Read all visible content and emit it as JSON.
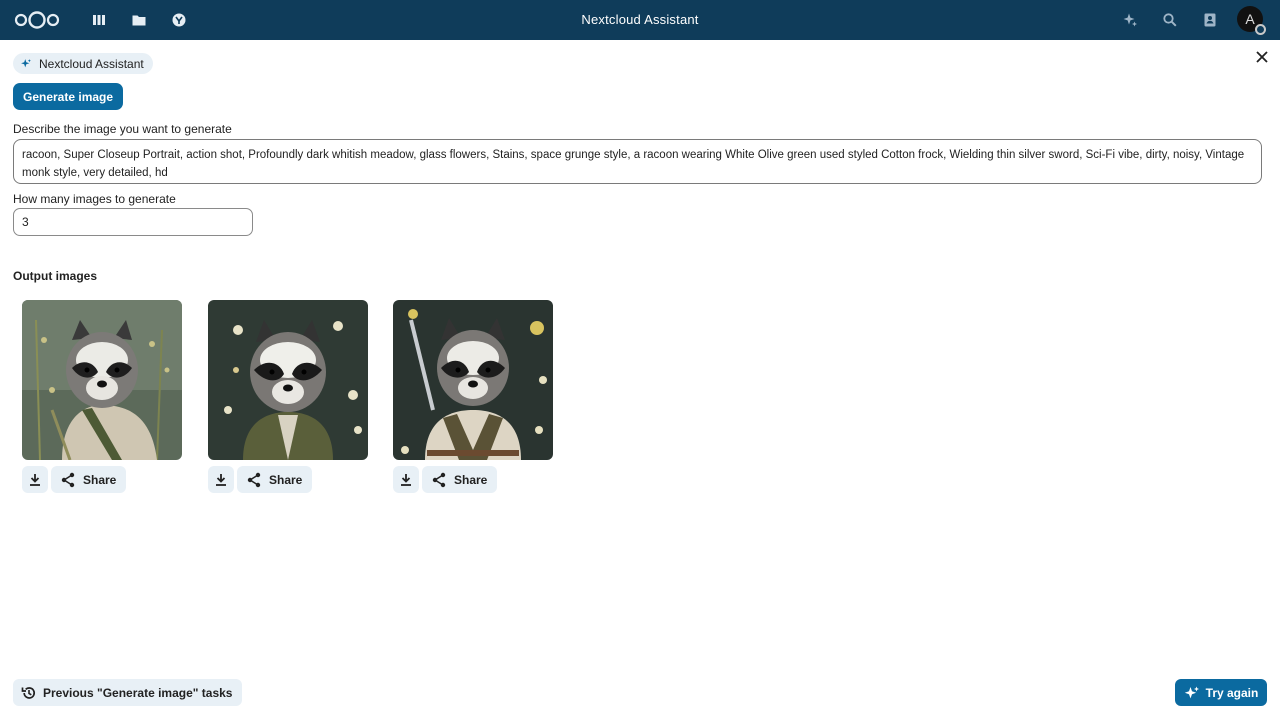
{
  "header": {
    "title": "Nextcloud Assistant",
    "avatar_initial": "A",
    "apps": [
      "dashboard-icon",
      "files-icon",
      "photos-icon"
    ],
    "right_icons": [
      "assistant-icon",
      "search-icon",
      "contacts-icon"
    ],
    "bg_color": "#0f3c5a"
  },
  "assistant": {
    "chip_label": "Nextcloud Assistant",
    "task_tab": "Generate image",
    "prompt_label": "Describe the image you want to generate",
    "prompt_value": "racoon, Super Closeup Portrait, action shot, Profoundly dark whitish meadow, glass flowers, Stains, space grunge style, a racoon wearing White Olive green used styled Cotton frock, Wielding thin silver sword, Sci-Fi vibe, dirty, noisy, Vintage monk style, very detailed, hd",
    "count_label": "How many images to generate",
    "count_value": "3",
    "output_title": "Output images",
    "share_label": "Share",
    "previous_tasks_label": "Previous \"Generate image\" tasks",
    "try_again_label": "Try again",
    "accent_color": "#0b6aa0"
  }
}
